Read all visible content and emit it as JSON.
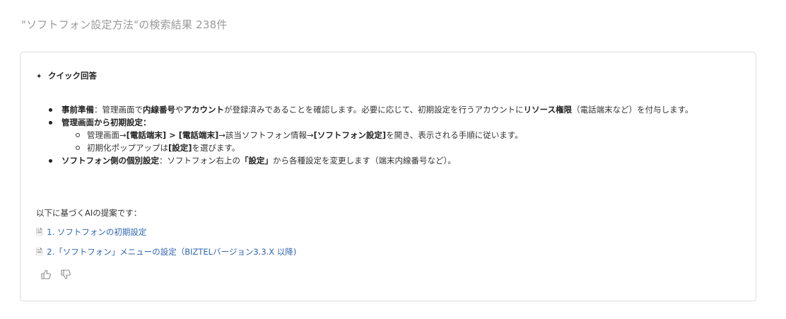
{
  "search": {
    "heading": "\"ソフトフォン設定方法\"の検索結果 238件"
  },
  "quick_answer": {
    "title": "クイック回答",
    "icon": "pin-icon",
    "items": [
      {
        "t1_bold": "事前準備",
        "t2": "：管理画面で",
        "t3_bold": "内線番号",
        "t4": "や",
        "t5_bold": "アカウント",
        "t6": "が登録済みであることを確認します。必要に応じて、初期設定を行うアカウントに",
        "t7_bold": "リソース権限",
        "t8": "（電話端末など）を付与します。"
      },
      {
        "t1_bold": "管理画面から初期設定：",
        "sub": [
          {
            "t1": "管理画面→",
            "t2_bold": "[電話端末] > [電話端末]",
            "t3": "→該当ソフトフォン情報→",
            "t4_bold": "[ソフトフォン設定]",
            "t5": "を開き、表示される手順に従います。"
          },
          {
            "t1": "初期化ポップアップは",
            "t2_bold": "[設定]",
            "t3": "を選びます。"
          }
        ]
      },
      {
        "t1_bold": "ソフトフォン側の個別設定",
        "t2": "：ソフトフォン右上の",
        "t3_bold": "「設定」",
        "t4": "から各種設定を変更します（端末内線番号など）。"
      }
    ]
  },
  "sources": {
    "label": "以下に基づくAIの提案です：",
    "links": [
      {
        "icon": "document-icon",
        "text": "1. ソフトフォンの初期設定"
      },
      {
        "icon": "document-icon",
        "text": "2.「ソフトフォン」メニューの設定（BIZTELバージョン3.3.X 以降)"
      }
    ]
  },
  "feedback": {
    "like_icon": "thumbs-up-icon",
    "dislike_icon": "thumbs-down-icon"
  }
}
